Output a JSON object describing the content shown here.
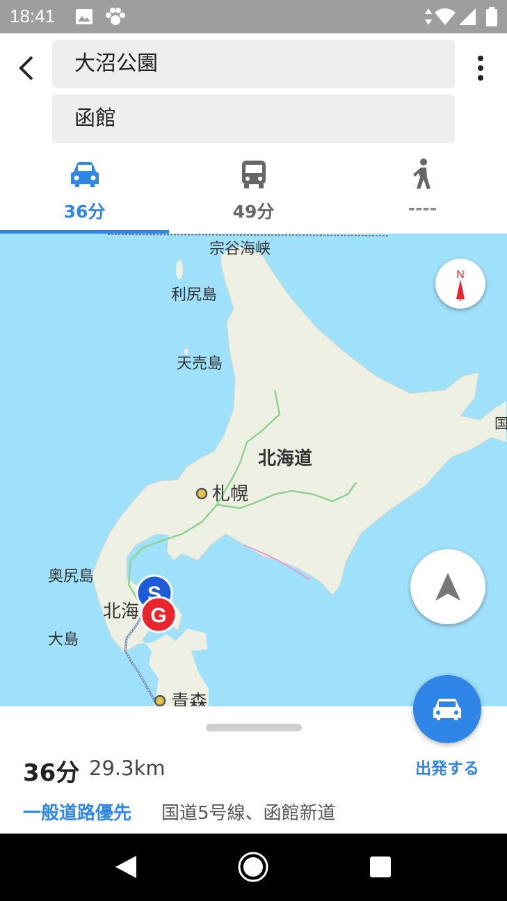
{
  "status_bar": {
    "time": "18:41"
  },
  "search": {
    "origin": "大沼公園",
    "destination": "函館"
  },
  "tabs": [
    {
      "label": "36分",
      "icon": "car-icon",
      "active": true
    },
    {
      "label": "49分",
      "icon": "bus-icon",
      "active": false
    },
    {
      "label": "----",
      "icon": "walk-icon",
      "active": false
    }
  ],
  "map": {
    "labels": {
      "strait": "宗谷海峡",
      "rishiri": "利尻島",
      "teuri": "天売島",
      "hokkaido": "北海道",
      "sapporo": "札幌",
      "okushiri": "奥尻島",
      "hokkai_partial": "北海",
      "oshima": "大島",
      "aomori": "青森",
      "edge": "国"
    },
    "start_marker": "S",
    "goal_marker": "G",
    "compass_letter": "N"
  },
  "route": {
    "duration": "36分",
    "distance": "29.3km",
    "priority": "一般道路優先",
    "roads": "国道5号線、函館新道",
    "start_label": "出発する"
  },
  "colors": {
    "accent": "#2f86e6",
    "map_water": "#9fe0fa",
    "map_land": "#eef0e4",
    "goal": "#e8242c",
    "start": "#1e5bd8"
  }
}
